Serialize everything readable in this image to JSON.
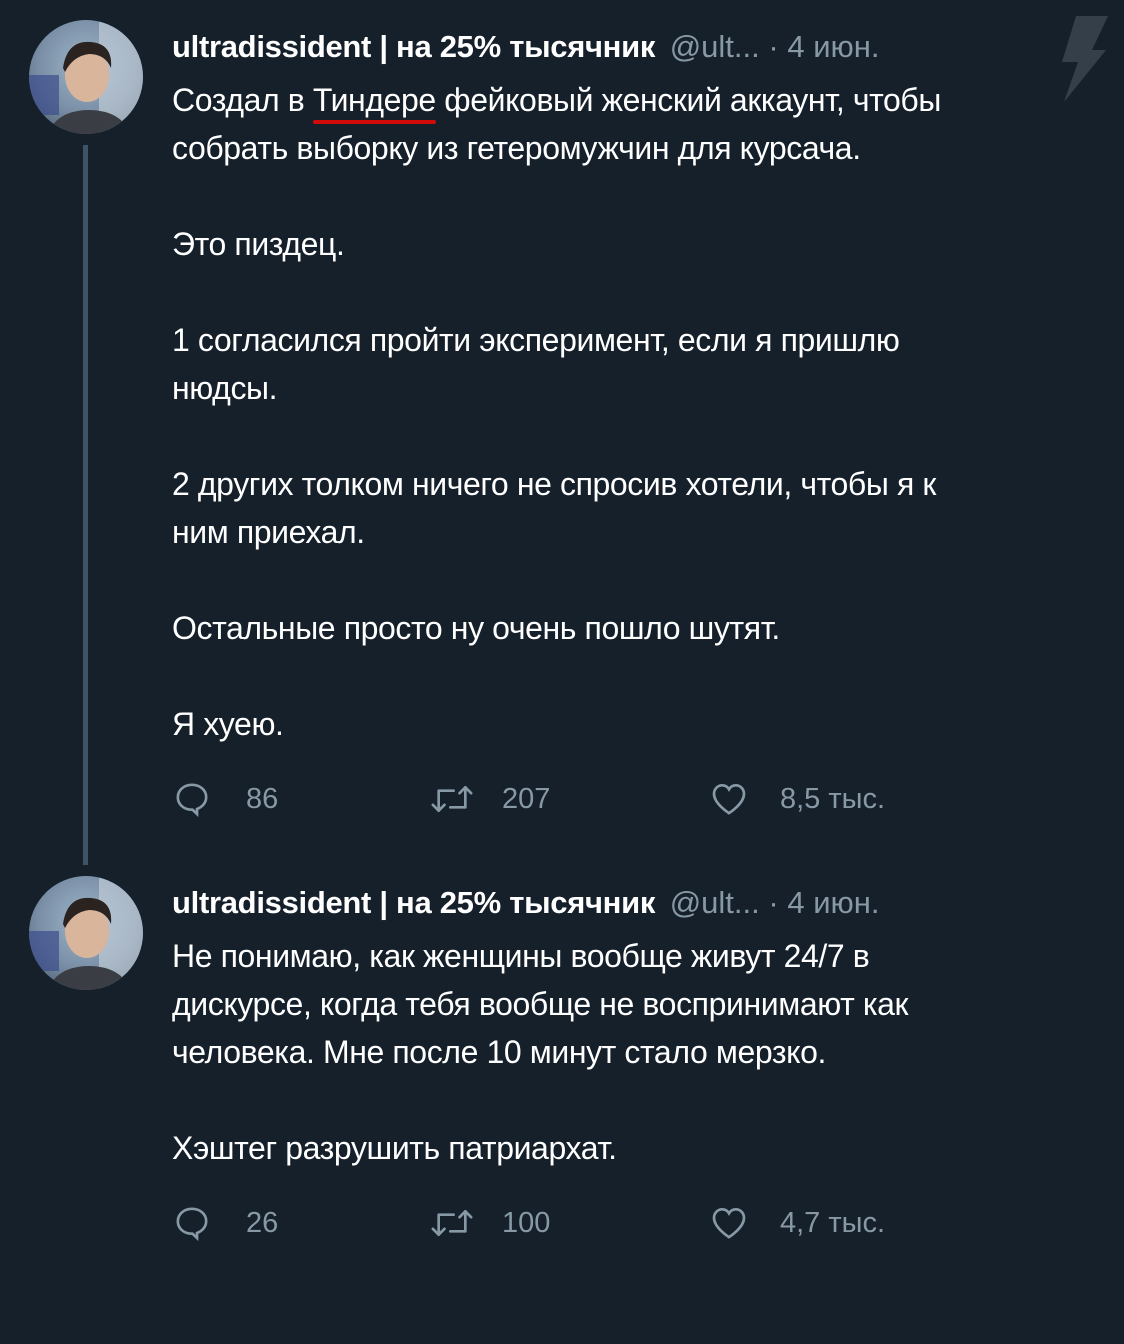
{
  "tweets": [
    {
      "display_name": "ultradissident | на 25% тысячник",
      "handle": "@ult...",
      "separator": "·",
      "date": "4 июн.",
      "text": {
        "l1_a": "Создал в ",
        "l1_underlined": "Тиндере",
        "l1_b": " фейковый женский аккаунт, чтобы",
        "l2": "собрать выборку из гетеромужчин для курсача.",
        "p2": "Это пиздец.",
        "p3_l1": "1 согласился пройти эксперимент, если я пришлю",
        "p3_l2": "нюдсы.",
        "p4_l1": "2 других толком ничего не спросив хотели, чтобы я к",
        "p4_l2": "ним приехал.",
        "p5": "Остальные просто ну очень пошло шутят.",
        "p6": "Я хуею."
      },
      "replies": "86",
      "retweets": "207",
      "likes": "8,5 тыс."
    },
    {
      "display_name": "ultradissident | на 25% тысячник",
      "handle": "@ult...",
      "separator": "·",
      "date": "4 июн.",
      "text": {
        "l1": "Не понимаю, как женщины вообще живут 24/7 в",
        "l2": "дискурсе, когда тебя вообще не воспринимают как",
        "l3": "человека. Мне после 10 минут стало мерзко.",
        "p2": "Хэштег разрушить патриархат."
      },
      "replies": "26",
      "retweets": "100",
      "likes": "4,7 тыс."
    }
  ],
  "icons": {
    "reply": "comment-bubble-icon",
    "retweet": "retweet-arrows-icon",
    "like": "heart-outline-icon",
    "watermark": "lightning-bolt-icon"
  },
  "colors": {
    "background": "#15202b",
    "text": "#ffffff",
    "muted": "#8899a6",
    "thread_line": "#3d5466",
    "underline": "#d10a0a"
  }
}
